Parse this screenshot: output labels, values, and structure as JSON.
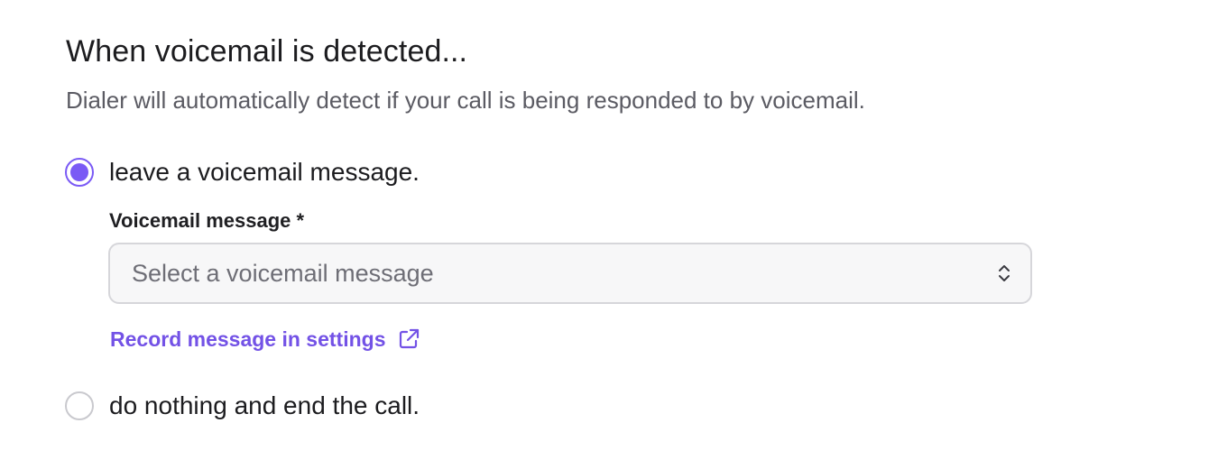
{
  "section": {
    "title": "When voicemail is detected...",
    "description": "Dialer will automatically detect if your call is being responded to by voicemail."
  },
  "options": [
    {
      "label": "leave a voicemail message.",
      "selected": true
    },
    {
      "label": "do nothing and end the call.",
      "selected": false
    }
  ],
  "voicemail_field": {
    "label": "Voicemail message *",
    "placeholder": "Select a voicemail message",
    "chevron_icon": "chevron-up-down-icon"
  },
  "record_link": {
    "label": "Record message in settings",
    "icon": "external-link-icon"
  },
  "colors": {
    "accent": "#7a5af5",
    "link": "#7352e6",
    "border": "#d6d6da",
    "radio_unselected_border": "#c9c9ce",
    "text_primary": "#1c1c1f",
    "text_secondary": "#5b5b63",
    "placeholder": "#6e6e76"
  }
}
